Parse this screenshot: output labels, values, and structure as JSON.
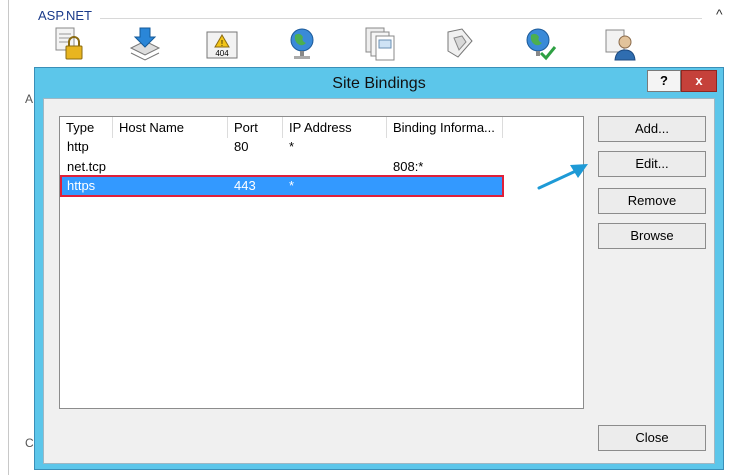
{
  "background": {
    "group_title": "ASP.NET",
    "caret": "^",
    "left_letters": [
      "A",
      "C"
    ],
    "icons": [
      "lock-icon",
      "stack-download-icon",
      "error-404-icon",
      "globe-icon",
      "documents-icon",
      "puzzle-icon",
      "globe-check-icon",
      "user-icon"
    ],
    "error_label": "404"
  },
  "dialog": {
    "title": "Site Bindings",
    "help_label": "?",
    "close_x_label": "x",
    "columns": [
      "Type",
      "Host Name",
      "Port",
      "IP Address",
      "Binding Informa..."
    ],
    "rows": [
      {
        "type": "http",
        "host": "",
        "port": "80",
        "ip": "*",
        "binding": ""
      },
      {
        "type": "net.tcp",
        "host": "",
        "port": "",
        "ip": "",
        "binding": "808:*"
      },
      {
        "type": "https",
        "host": "",
        "port": "443",
        "ip": "*",
        "binding": ""
      }
    ],
    "selected_row": 2,
    "buttons": {
      "add": "Add...",
      "edit": "Edit...",
      "remove": "Remove",
      "browse": "Browse",
      "close": "Close"
    }
  },
  "colors": {
    "dialog_frame": "#5cc6ea",
    "selection": "#3399ff",
    "highlight_box": "#e0203a",
    "close_button": "#c5413a",
    "annotation_arrow": "#1e9ad6"
  }
}
